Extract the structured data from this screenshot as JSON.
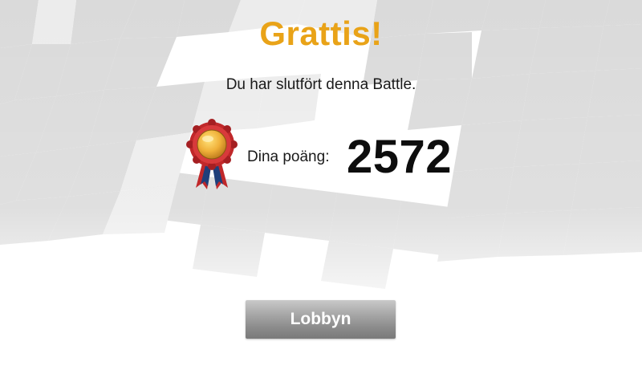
{
  "result": {
    "title": "Grattis!",
    "message": "Du har slutfört denna Battle.",
    "score_label": "Dina poäng:",
    "score_value": "2572"
  },
  "actions": {
    "lobby_label": "Lobbyn"
  },
  "icons": {
    "medal": "award-medal-icon",
    "background": "checkered-flag"
  },
  "colors": {
    "title": "#e9a318",
    "button": "#9a9a9a",
    "ribbon_red": "#c0282a",
    "ribbon_blue": "#1f3f7a"
  }
}
